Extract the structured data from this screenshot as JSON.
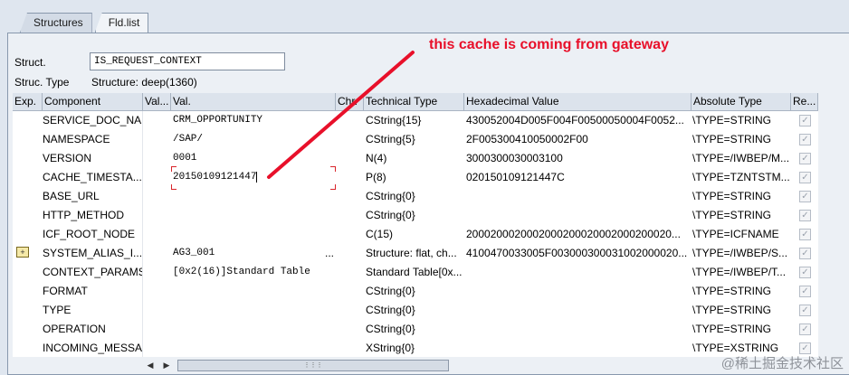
{
  "tabs": [
    "Structures",
    "Fld.list"
  ],
  "struct": {
    "label": "Struct.",
    "value": "IS_REQUEST_CONTEXT"
  },
  "struct_type": {
    "label": "Struc. Type",
    "value": "Structure: deep(1360)"
  },
  "annotation": "this cache is coming from gateway",
  "columns": {
    "exp": "Exp.",
    "component": "Component",
    "val_short": "Val...",
    "val": "Val.",
    "chr": "Chr.",
    "technical_type": "Technical Type",
    "hex": "Hexadecimal Value",
    "absolute_type": "Absolute Type",
    "re": "Re..."
  },
  "rows": [
    {
      "component": "SERVICE_DOC_NA...",
      "val": "CRM_OPPORTUNITY",
      "technical_type": "CString{15}",
      "hex": "430052004D005F004F00500050004F0052...",
      "absolute_type": "\\TYPE=STRING"
    },
    {
      "component": "NAMESPACE",
      "val": "/SAP/",
      "technical_type": "CString{5}",
      "hex": "2F005300410050002F00",
      "absolute_type": "\\TYPE=STRING"
    },
    {
      "component": "VERSION",
      "val": "0001",
      "technical_type": "N(4)",
      "hex": "3000300030003100",
      "absolute_type": "\\TYPE=/IWBEP/M..."
    },
    {
      "component": "CACHE_TIMESTA...",
      "val": "20150109121447",
      "technical_type": "P(8)",
      "hex": "020150109121447C",
      "absolute_type": "\\TYPE=TZNTSTM..."
    },
    {
      "component": "BASE_URL",
      "val": "",
      "technical_type": "CString{0}",
      "hex": "",
      "absolute_type": "\\TYPE=STRING"
    },
    {
      "component": "HTTP_METHOD",
      "val": "",
      "technical_type": "CString{0}",
      "hex": "",
      "absolute_type": "\\TYPE=STRING"
    },
    {
      "component": "ICF_ROOT_NODE",
      "val": "",
      "technical_type": "C(15)",
      "hex": "2000200020002000200020002000200020...",
      "absolute_type": "\\TYPE=ICFNAME"
    },
    {
      "component": "SYSTEM_ALIAS_I...",
      "val": "AG3_001",
      "val_more": "...",
      "technical_type": "Structure: flat, ch...",
      "hex": "4100470033005F003000300031002000020...",
      "absolute_type": "\\TYPE=/IWBEP/S..."
    },
    {
      "component": "CONTEXT_PARAMS",
      "val": "[0x2(16)]Standard Table",
      "technical_type": "Standard Table[0x...",
      "hex": "",
      "absolute_type": "\\TYPE=/IWBEP/T..."
    },
    {
      "component": "FORMAT",
      "val": "",
      "technical_type": "CString{0}",
      "hex": "",
      "absolute_type": "\\TYPE=STRING"
    },
    {
      "component": "TYPE",
      "val": "",
      "technical_type": "CString{0}",
      "hex": "",
      "absolute_type": "\\TYPE=STRING"
    },
    {
      "component": "OPERATION",
      "val": "",
      "technical_type": "CString{0}",
      "hex": "",
      "absolute_type": "\\TYPE=STRING"
    },
    {
      "component": "INCOMING_MESSA...",
      "val": "",
      "technical_type": "XString{0}",
      "hex": "",
      "absolute_type": "\\TYPE=XSTRING"
    }
  ],
  "watermark": "@稀土掘金技术社区",
  "colors": {
    "annotation": "#e8102a",
    "header_bg": "#dce3ec",
    "panel_bg": "#ecf0f5"
  }
}
